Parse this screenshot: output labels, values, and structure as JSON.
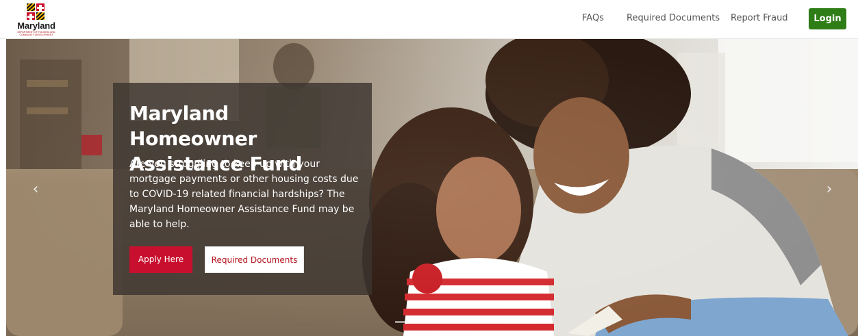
{
  "header": {
    "logo": {
      "name": "Maryland",
      "subtitle": "Department of Housing and Community Development"
    },
    "nav": [
      {
        "label": "FAQs"
      },
      {
        "label": "Required Documents"
      },
      {
        "label": "Report Fraud"
      }
    ],
    "login_label": "Login"
  },
  "hero": {
    "title": "Maryland Homeowner Assistance Fund",
    "description": "Are you struggling to keep up with your mortgage payments or other housing costs due to COVID-19 related financial hardships? The Maryland Homeowner Assistance Fund may be able to help.",
    "apply_label": "Apply Here",
    "documents_label": "Required Documents",
    "prev_arrow": "‹",
    "next_arrow": "›",
    "slide_count": 3,
    "active_slide": 3
  },
  "colors": {
    "login": "#2e7d16",
    "apply": "#c8102e",
    "documents_text": "#b5121b"
  },
  "icons": {
    "logo": "maryland-flag-icon",
    "prev": "chevron-left-icon",
    "next": "chevron-right-icon"
  }
}
